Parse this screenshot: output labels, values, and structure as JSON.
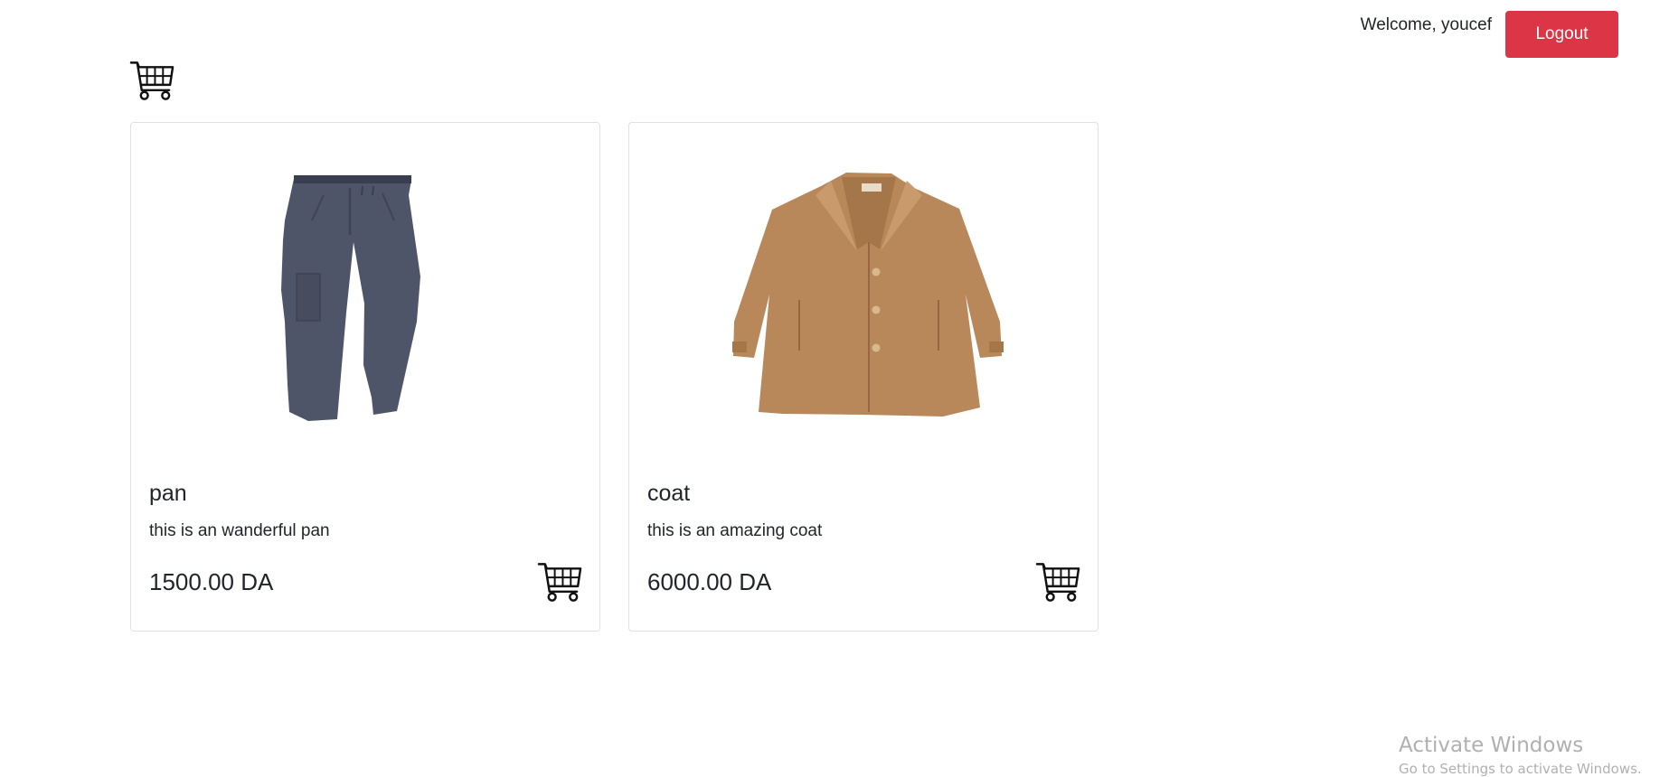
{
  "header": {
    "welcome": "Welcome, youcef",
    "logout_label": "Logout"
  },
  "icons": {
    "top_cart": "shopping-cart-icon",
    "card_cart": "shopping-cart-icon"
  },
  "colors": {
    "logout": "#dc3545",
    "pants": "#4f5568",
    "coat": "#b8875a"
  },
  "products": [
    {
      "name": "pan",
      "description": "this is an wanderful pan",
      "price": "1500.00 DA",
      "image": "pants"
    },
    {
      "name": "coat",
      "description": "this is an amazing coat",
      "price": "6000.00 DA",
      "image": "coat"
    }
  ],
  "watermark": {
    "title": "Activate Windows",
    "subtitle": "Go to Settings to activate Windows."
  }
}
